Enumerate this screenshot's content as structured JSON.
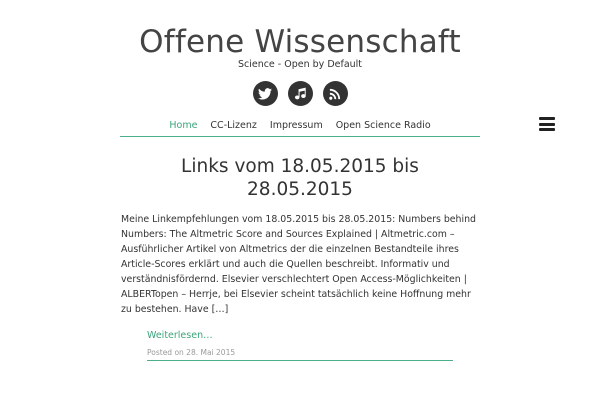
{
  "site": {
    "title": "Offene Wissenschaft",
    "tagline": "Science - Open by Default"
  },
  "social": [
    {
      "icon": "twitter-icon"
    },
    {
      "icon": "music-icon"
    },
    {
      "icon": "rss-icon"
    }
  ],
  "nav": {
    "items": [
      {
        "label": "Home",
        "active": true
      },
      {
        "label": "CC-Lizenz"
      },
      {
        "label": "Impressum"
      },
      {
        "label": "Open Science Radio"
      }
    ],
    "menu_icon": "hamburger-menu-icon"
  },
  "post": {
    "title_line1": "Links vom 18.05.2015 bis",
    "title_line2": "28.05.2015",
    "excerpt": "Meine Linkempfehlungen vom 18.05.2015 bis 28.05.2015: Numbers behind Numbers: The Altmetric Score and Sources Explained | Altmetric.com – Ausführlicher Artikel von Altmetrics der die einzelnen Bestandteile ihres Article-Scores erklärt und auch die Quellen beschreibt. Informativ und verständnisfördernd. Elsevier verschlechtert Open Access-Möglichkeiten | ALBERTopen – Herrje, bei Elsevier scheint tatsächlich keine Hoffnung mehr zu bestehen. Have […]",
    "read_more": "Weiterlesen…",
    "meta": "Posted on 28. Mai 2015"
  },
  "colors": {
    "accent": "#3aa57a",
    "text": "#333333",
    "icon_bg": "#333333",
    "meta": "#9a9a9a"
  }
}
